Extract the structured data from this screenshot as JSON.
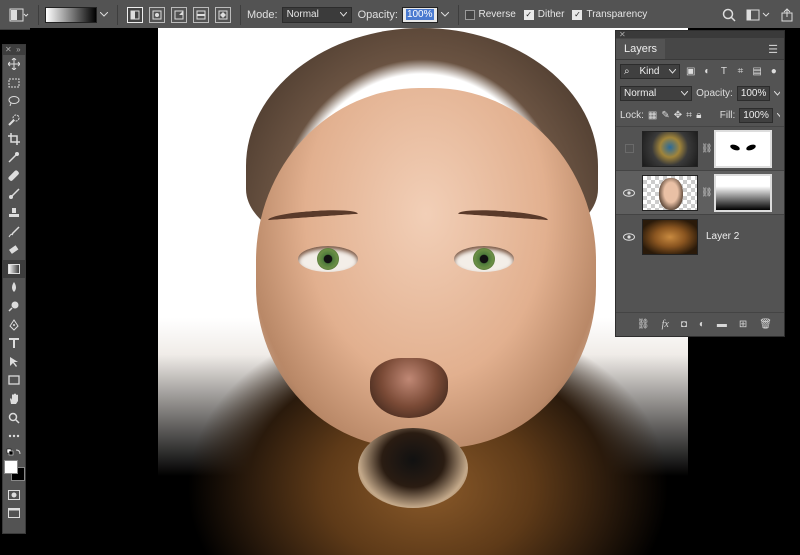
{
  "options_bar": {
    "mode_label": "Mode:",
    "mode_value": "Normal",
    "opacity_label": "Opacity:",
    "opacity_value": "100%",
    "reverse_label": "Reverse",
    "reverse_checked": false,
    "dither_label": "Dither",
    "dither_checked": true,
    "transparency_label": "Transparency",
    "transparency_checked": true
  },
  "toolbar": {
    "tools": [
      "move-tool",
      "marquee-tool",
      "lasso-tool",
      "quick-selection-tool",
      "crop-tool",
      "eyedropper-tool",
      "healing-brush-tool",
      "brush-tool",
      "clone-stamp-tool",
      "history-brush-tool",
      "eraser-tool",
      "gradient-tool",
      "blur-tool",
      "dodge-tool",
      "pen-tool",
      "type-tool",
      "path-selection-tool",
      "rectangle-tool",
      "hand-tool",
      "zoom-tool",
      "more-tools"
    ],
    "active_tool": "gradient-tool"
  },
  "layers_panel": {
    "title": "Layers",
    "filter_kind": "Kind",
    "blend_mode": "Normal",
    "opacity_label": "Opacity:",
    "opacity_value": "100%",
    "lock_label": "Lock:",
    "fill_label": "Fill:",
    "fill_value": "100%",
    "layers": [
      {
        "name": "",
        "visible": false,
        "thumb": "mask-face",
        "has_mask": true,
        "mask": "black-eyes"
      },
      {
        "name": "",
        "visible": true,
        "thumb": "woman",
        "has_mask": true,
        "mask": "white-to-black",
        "selected": true
      },
      {
        "name": "Layer 2",
        "visible": true,
        "thumb": "lion",
        "has_mask": false
      }
    ]
  },
  "colors": {
    "panel_bg": "#535353",
    "canvas_bg": "#000000",
    "accent": "#4a7ad0"
  }
}
